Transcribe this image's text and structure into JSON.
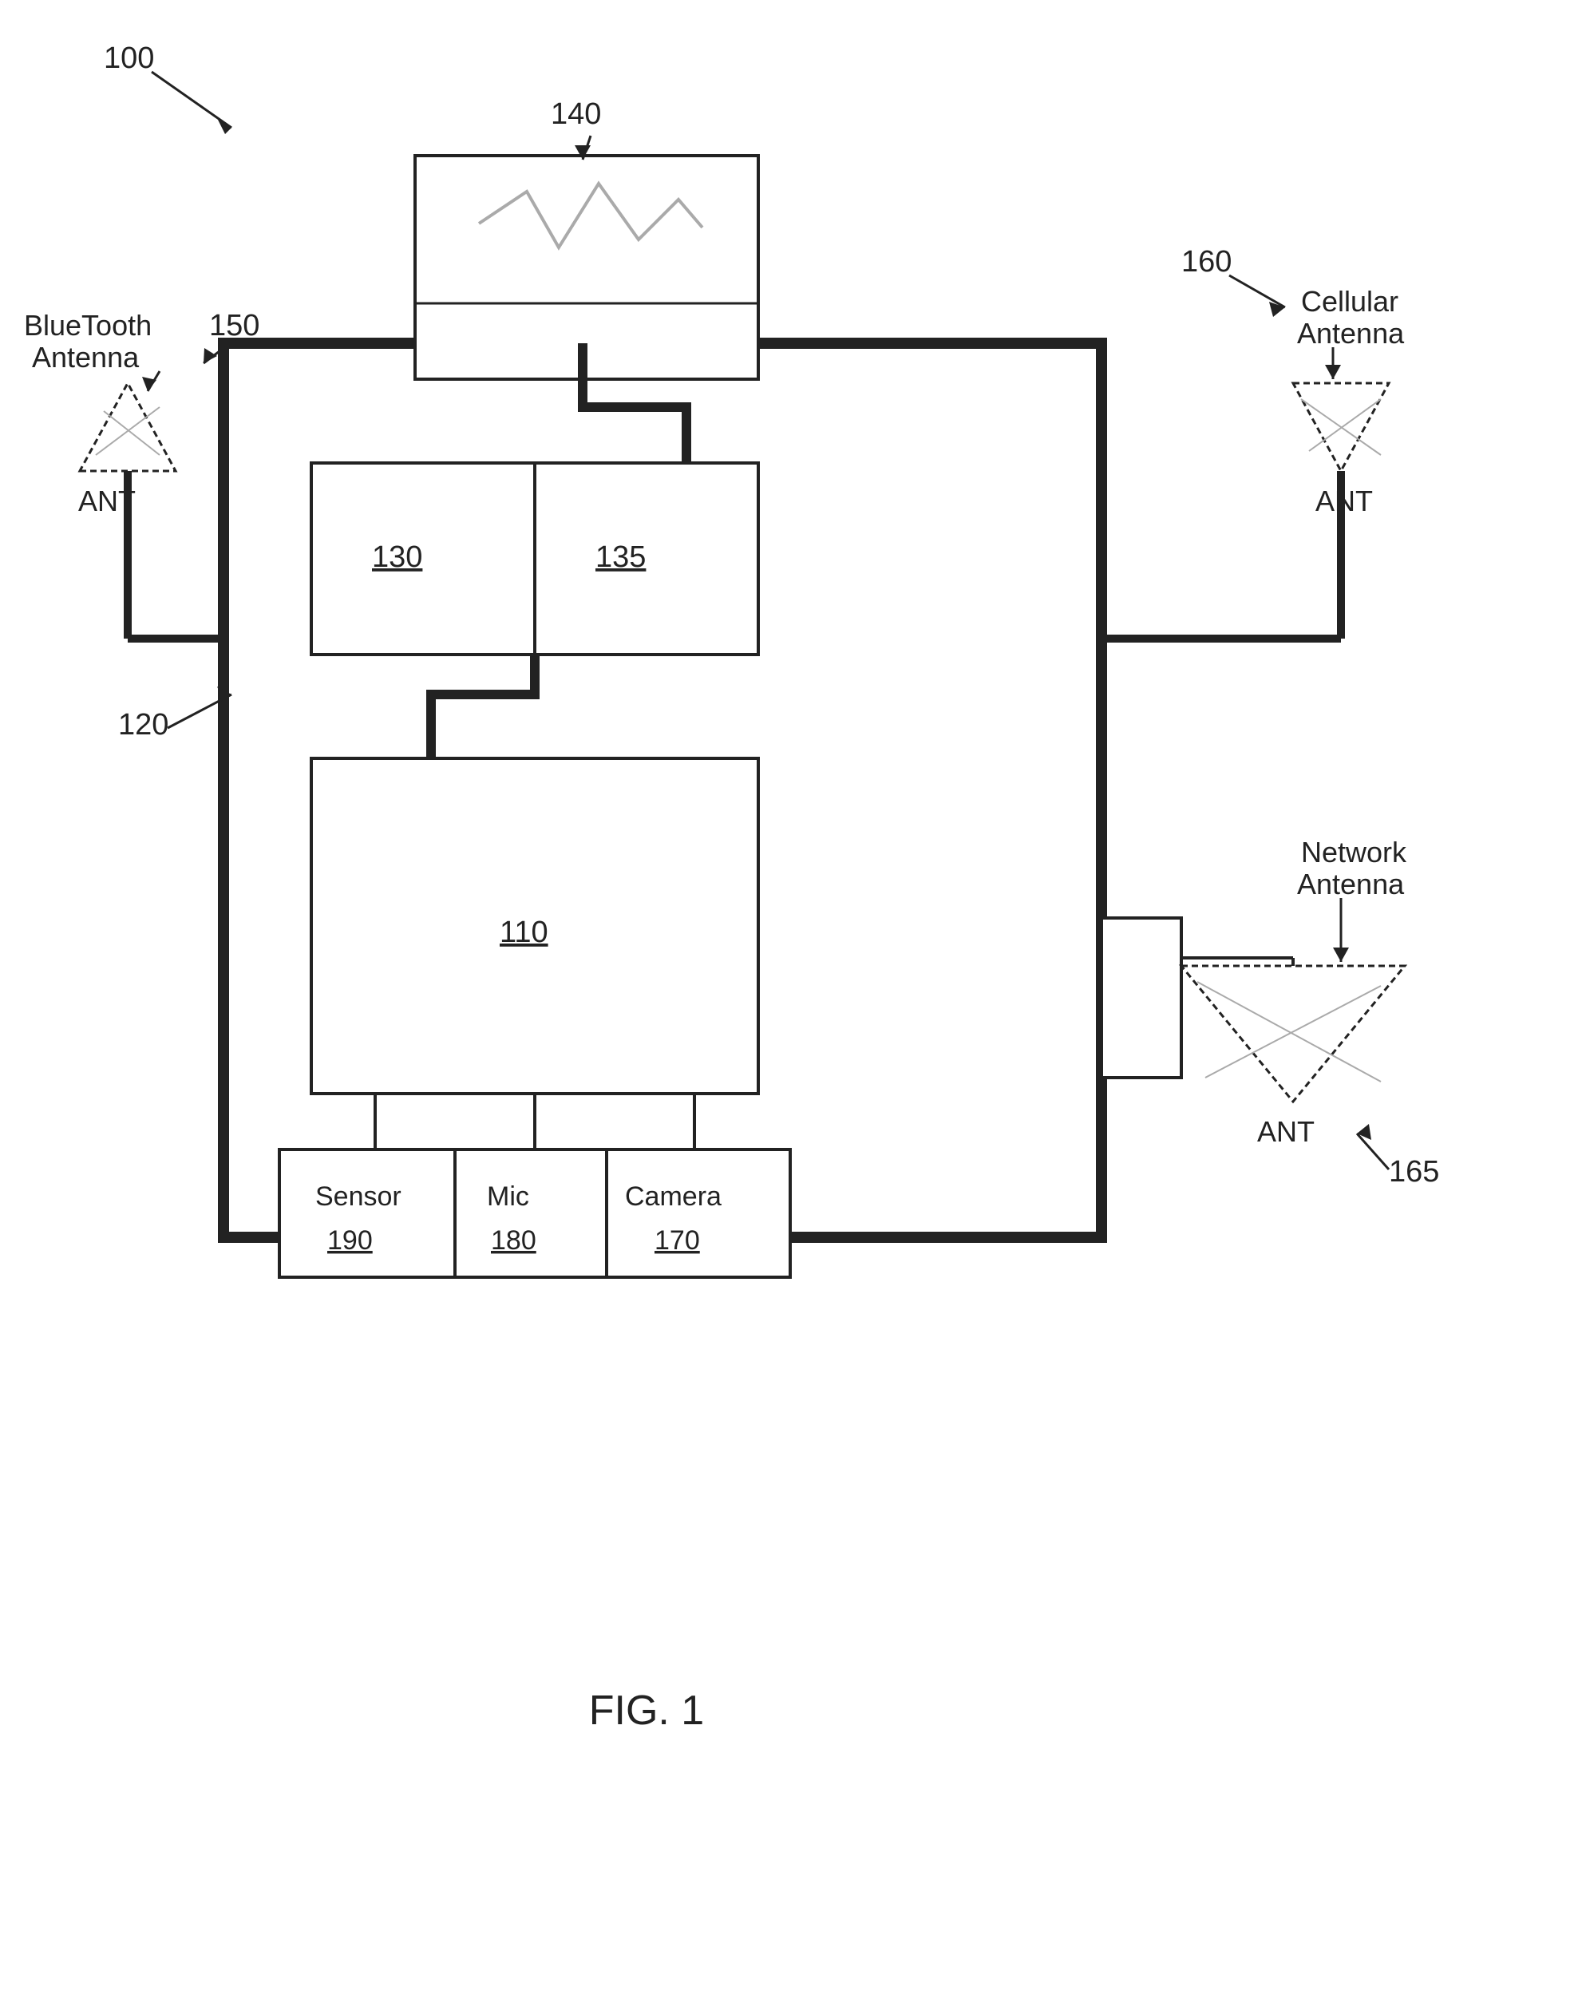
{
  "diagram": {
    "title": "FIG. 1",
    "labels": {
      "main_ref": "100",
      "bluetooth_label1": "BlueTooth",
      "bluetooth_label2": "Antenna",
      "ant_bt": "ANT",
      "ref_150": "150",
      "ref_120": "120",
      "ref_140": "140",
      "cellular_label1": "Cellular",
      "cellular_label2": "Antenna",
      "ant_cell": "ANT",
      "ref_160": "160",
      "network_label1": "Network",
      "network_label2": "Antenna",
      "ant_net": "ANT",
      "ref_165": "165",
      "ref_110": "110",
      "ref_130": "130",
      "ref_135": "135",
      "sensor_label": "Sensor",
      "sensor_ref": "190",
      "mic_label": "Mic",
      "mic_ref": "180",
      "camera_label": "Camera",
      "camera_ref": "170",
      "fig_label": "FIG. 1"
    }
  }
}
